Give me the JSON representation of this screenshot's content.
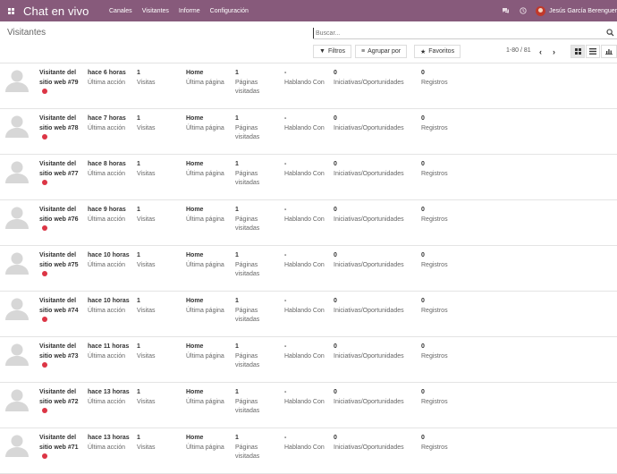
{
  "navbar": {
    "app_title": "Chat en vivo",
    "menu": [
      "Canales",
      "Visitantes",
      "Informe",
      "Configuración"
    ],
    "user_name": "Jesús García Berenguer"
  },
  "control_panel": {
    "title": "Visitantes",
    "search_placeholder": "Buscar...",
    "filters_label": "Filtros",
    "group_by_label": "Agrupar por",
    "favorites_label": "Favoritos",
    "pager": "1-80 / 81"
  },
  "labels": {
    "last_action": "Última acción",
    "visits": "Visitas",
    "last_page": "Última página",
    "pages_visited": "Páginas visitadas",
    "talking_with": "Hablando Con",
    "leads": "Iniciativas/Oportunidades",
    "records": "Registros"
  },
  "visitors": [
    {
      "name": "Visitante del sitio web #79",
      "time": "hace 6 horas",
      "visits": "1",
      "page": "Home",
      "pages": "1",
      "talking": "-",
      "leads": "0",
      "records": "0"
    },
    {
      "name": "Visitante del sitio web #78",
      "time": "hace 7 horas",
      "visits": "1",
      "page": "Home",
      "pages": "1",
      "talking": "-",
      "leads": "0",
      "records": "0"
    },
    {
      "name": "Visitante del sitio web #77",
      "time": "hace 8 horas",
      "visits": "1",
      "page": "Home",
      "pages": "1",
      "talking": "-",
      "leads": "0",
      "records": "0"
    },
    {
      "name": "Visitante del sitio web #76",
      "time": "hace 9 horas",
      "visits": "1",
      "page": "Home",
      "pages": "1",
      "talking": "-",
      "leads": "0",
      "records": "0"
    },
    {
      "name": "Visitante del sitio web #75",
      "time": "hace 10 horas",
      "visits": "1",
      "page": "Home",
      "pages": "1",
      "talking": "-",
      "leads": "0",
      "records": "0"
    },
    {
      "name": "Visitante del sitio web #74",
      "time": "hace 10 horas",
      "visits": "1",
      "page": "Home",
      "pages": "1",
      "talking": "-",
      "leads": "0",
      "records": "0"
    },
    {
      "name": "Visitante del sitio web #73",
      "time": "hace 11 horas",
      "visits": "1",
      "page": "Home",
      "pages": "1",
      "talking": "-",
      "leads": "0",
      "records": "0"
    },
    {
      "name": "Visitante del sitio web #72",
      "time": "hace 13 horas",
      "visits": "1",
      "page": "Home",
      "pages": "1",
      "talking": "-",
      "leads": "0",
      "records": "0"
    },
    {
      "name": "Visitante del sitio web #71",
      "time": "hace 13 horas",
      "visits": "1",
      "page": "Home",
      "pages": "1",
      "talking": "-",
      "leads": "0",
      "records": "0"
    }
  ],
  "colors": {
    "navbar": "#875a7b",
    "status_dot": "#dc3545"
  }
}
